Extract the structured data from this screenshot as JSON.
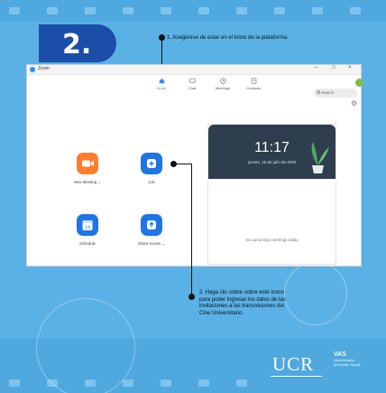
{
  "step_number": "2.",
  "callouts": {
    "step1": "1. Asegúrese de estar en el inicio de la plataforma.",
    "step2_lines": [
      "2. Haga clic sobre sobre este ícono",
      "para poder ingresar los datos de las",
      "invitaciones a las transmisiones del",
      "Cine Universitario."
    ]
  },
  "zoom_window": {
    "title": "Zoom",
    "controls": [
      "–",
      "□",
      "×"
    ],
    "nav": [
      {
        "label": "Home",
        "icon": "home-icon",
        "active": true
      },
      {
        "label": "Chat",
        "icon": "chat-icon",
        "active": false
      },
      {
        "label": "Meetings",
        "icon": "clock-icon",
        "active": false
      },
      {
        "label": "Contacts",
        "icon": "contacts-icon",
        "active": false
      }
    ],
    "search_placeholder": "Search",
    "actions": [
      {
        "label": "New Meeting ⌄",
        "icon": "video-camera-icon",
        "color": "#fe7d2d"
      },
      {
        "label": "Join",
        "icon": "plus-icon",
        "color": "#1f75e6"
      },
      {
        "label": "Schedule",
        "icon": "calendar-icon",
        "color": "#1f75e6",
        "icon_text": "19"
      },
      {
        "label": "Share screen ⌄",
        "icon": "share-screen-icon",
        "color": "#1f75e6"
      }
    ],
    "clock": {
      "time": "11:17",
      "date": "jueves, 16 de julio de 2020"
    },
    "no_meetings": "No upcoming meetings today"
  },
  "branding": {
    "ucr": "UCR",
    "vas": "VAS",
    "vas_lines": [
      "Vicerrectoría",
      "de Acción Social"
    ]
  },
  "colors": {
    "background": "#5ab1e5",
    "badge": "#1a4ea8",
    "zoom_blue": "#1f75e6",
    "zoom_orange": "#fe7d2d"
  }
}
